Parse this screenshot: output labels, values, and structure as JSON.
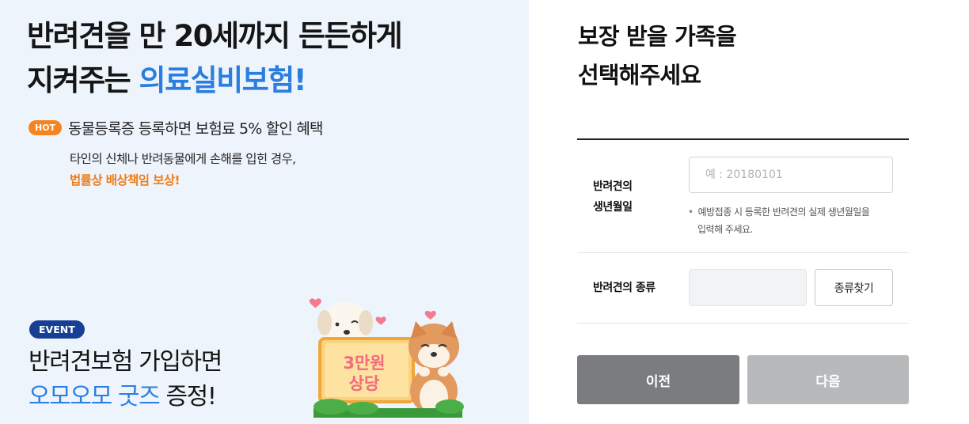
{
  "promo": {
    "headline_line1": "반려견을 만 20세까지 든든하게",
    "headline_line2_prefix": "지켜주는 ",
    "headline_line2_accent": "의료실비보험!",
    "hot_badge": "HOT",
    "hot_text": "동물등록증 등록하면 보험료 5% 할인 혜택",
    "desc_line1": "타인의 신체나 반려동물에게 손해를 입힌 경우,",
    "desc_line2": "법률상 배상책임 보상!",
    "event_badge": "EVENT",
    "event_line1": "반려견보험 가입하면",
    "event_line2_accent": "오모오모 굿즈",
    "event_line2_suffix": " 증정!",
    "sign_line1": "3만원",
    "sign_line2": "상당"
  },
  "form": {
    "title_line1": "보장 받을 가족을",
    "title_line2": "선택해주세요",
    "birth_label_line1": "반려견의",
    "birth_label_line2": "생년월일",
    "birth_placeholder": "예 : 20180101",
    "birth_value": "",
    "birth_hint_line1": "예방접종 시 등록한 반려견의 실제 생년월일을",
    "birth_hint_line2": "입력해 주세요.",
    "breed_label": "반려견의 종류",
    "breed_value": "",
    "find_breed_button": "종류찾기",
    "prev_button": "이전",
    "next_button": "다음"
  },
  "colors": {
    "accent_blue": "#2b7ee0",
    "hot_orange": "#f5841f",
    "event_navy": "#173f96",
    "prev_gray": "#7b7c80",
    "next_disabled_gray": "#b8b9bb"
  }
}
